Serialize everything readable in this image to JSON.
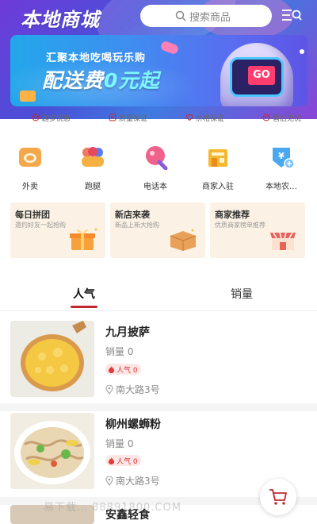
{
  "header": {
    "app_title": "本地商城",
    "search_placeholder": "搜索商品",
    "menu_icon": "menu-search-icon"
  },
  "banner": {
    "subtitle": "汇聚本地吃喝玩乐购",
    "headline_prefix": "配送费",
    "headline_highlight": "0元起",
    "button_label": "GO"
  },
  "guarantees": [
    {
      "icon": "coupon-icon",
      "label": "超多优惠"
    },
    {
      "icon": "quality-icon",
      "label": "质量保证"
    },
    {
      "icon": "heart-icon",
      "label": "价格保证"
    },
    {
      "icon": "return-icon",
      "label": "售后无忧"
    }
  ],
  "categories": [
    {
      "icon": "takeout-icon",
      "label": "外卖"
    },
    {
      "icon": "errand-icon",
      "label": "跑腿"
    },
    {
      "icon": "phonebook-icon",
      "label": "电话本"
    },
    {
      "icon": "merchant-icon",
      "label": "商家入驻"
    },
    {
      "icon": "farm-product-icon",
      "label": "本地农…"
    }
  ],
  "promos": [
    {
      "title": "每日拼团",
      "subtitle": "邀约好友一起抢购",
      "icon": "gift-box-icon"
    },
    {
      "title": "新店来袭",
      "subtitle": "新品上新大抢购",
      "icon": "parcel-icon"
    },
    {
      "title": "商家推荐",
      "subtitle": "优质商家榜单推荐",
      "icon": "shop-icon"
    }
  ],
  "tabs": [
    {
      "label": "人气",
      "active": true
    },
    {
      "label": "销量",
      "active": false
    }
  ],
  "items": [
    {
      "name": "九月披萨",
      "sales": "销量 0",
      "popularity": "人气 0",
      "address": "南大路3号"
    },
    {
      "name": "柳州螺蛳粉",
      "sales": "销量 0",
      "popularity": "人气 0",
      "address": "南大路3号"
    },
    {
      "name": "安鑫轻食"
    }
  ],
  "cart": {
    "icon": "cart-icon"
  },
  "watermark": "易下载… 88891800.COM",
  "colors": {
    "accent": "#c0282d",
    "banner_blue": "#3f8ef0",
    "promo_bg": "#fbf1e4"
  }
}
